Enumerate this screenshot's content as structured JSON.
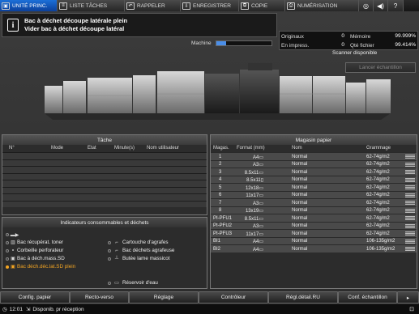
{
  "tabs": {
    "home": "UNITÉ PRINC.",
    "jobs": "LISTE TÂCHES",
    "call": "RAPPELER",
    "save": "ENREGISTRER",
    "copy": "COPIE",
    "number": "NUMÉRISATION"
  },
  "message": {
    "line1": "Bac à déchet découpe latérale plein",
    "line2": "Vider bac à déchet découpe latéral"
  },
  "machine": {
    "label": "Machine",
    "progress": 0.17
  },
  "counters": {
    "originals_label": "Originaux",
    "originals": "0",
    "memory_label": "Mémoire",
    "memory": "99.999%",
    "printing_label": "En impress.",
    "printing": "0",
    "file_label": "Qté fichier",
    "file": "99.414%"
  },
  "scanner_status": "Scanner disponible",
  "sample_button": "Lancer échantillon",
  "tache": {
    "title": "Tâche",
    "cols": {
      "no": "N°",
      "mode": "Mode",
      "etat": "Etat",
      "minutes": "Minute(s)",
      "user": "Nom utilisateur"
    }
  },
  "conso": {
    "title": "Indicateurs consommables et déchets",
    "items": [
      "Bac récupérat. toner",
      "Corbeille perforateur",
      "Bac à déch.mass.SD",
      "Bac déch.déc.lat.SD plein",
      "Cartouche d'agrafes",
      "Bac déchets agrafeuse",
      "Butée lame massicot",
      "Réservoir d'eau"
    ]
  },
  "magasin": {
    "title": "Magasin papier",
    "cols": {
      "mag": "Magas.",
      "format": "Format (mm)",
      "nom": "Nom",
      "grammage": "Grammage"
    },
    "rows": [
      {
        "mag": "1",
        "format": "A4▭",
        "nom": "Normal",
        "gram": "62-74g/m2"
      },
      {
        "mag": "2",
        "format": "A3▭",
        "nom": "Normal",
        "gram": "62-74g/m2"
      },
      {
        "mag": "3",
        "format": "8.5x11▭",
        "nom": "Normal",
        "gram": "62-74g/m2"
      },
      {
        "mag": "4",
        "format": "8.5x11▯",
        "nom": "Normal",
        "gram": "62-74g/m2"
      },
      {
        "mag": "5",
        "format": "12x18▭",
        "nom": "Normal",
        "gram": "62-74g/m2"
      },
      {
        "mag": "6",
        "format": "11x17▭",
        "nom": "Normal",
        "gram": "62-74g/m2"
      },
      {
        "mag": "7",
        "format": "A3▭",
        "nom": "Normal",
        "gram": "62-74g/m2"
      },
      {
        "mag": "8",
        "format": "13x19▭",
        "nom": "Normal",
        "gram": "62-74g/m2"
      },
      {
        "mag": "PI-PFU1",
        "format": "8.5x11▭",
        "nom": "Normal",
        "gram": "62-74g/m2"
      },
      {
        "mag": "PI-PFU2",
        "format": "A3▭",
        "nom": "Normal",
        "gram": "62-74g/m2"
      },
      {
        "mag": "PI-PFU3",
        "format": "11x17▭",
        "nom": "Normal",
        "gram": "62-74g/m2"
      },
      {
        "mag": "BI1",
        "format": "A4▭",
        "nom": "Normal",
        "gram": "106-135g/m2"
      },
      {
        "mag": "BI2",
        "format": "A4▭",
        "nom": "Normal",
        "gram": "106-135g/m2"
      }
    ]
  },
  "bottom": [
    "Config. papier",
    "Recto-verso",
    "Réglage",
    "Contrôleur",
    "Régl.détail.RU",
    "Conf. échantillon"
  ],
  "status": {
    "time": "12:01",
    "text": "Disponib. pr réception"
  },
  "colors": {
    "tab_active": "#1c6fd8",
    "warning": "#f5a623"
  }
}
